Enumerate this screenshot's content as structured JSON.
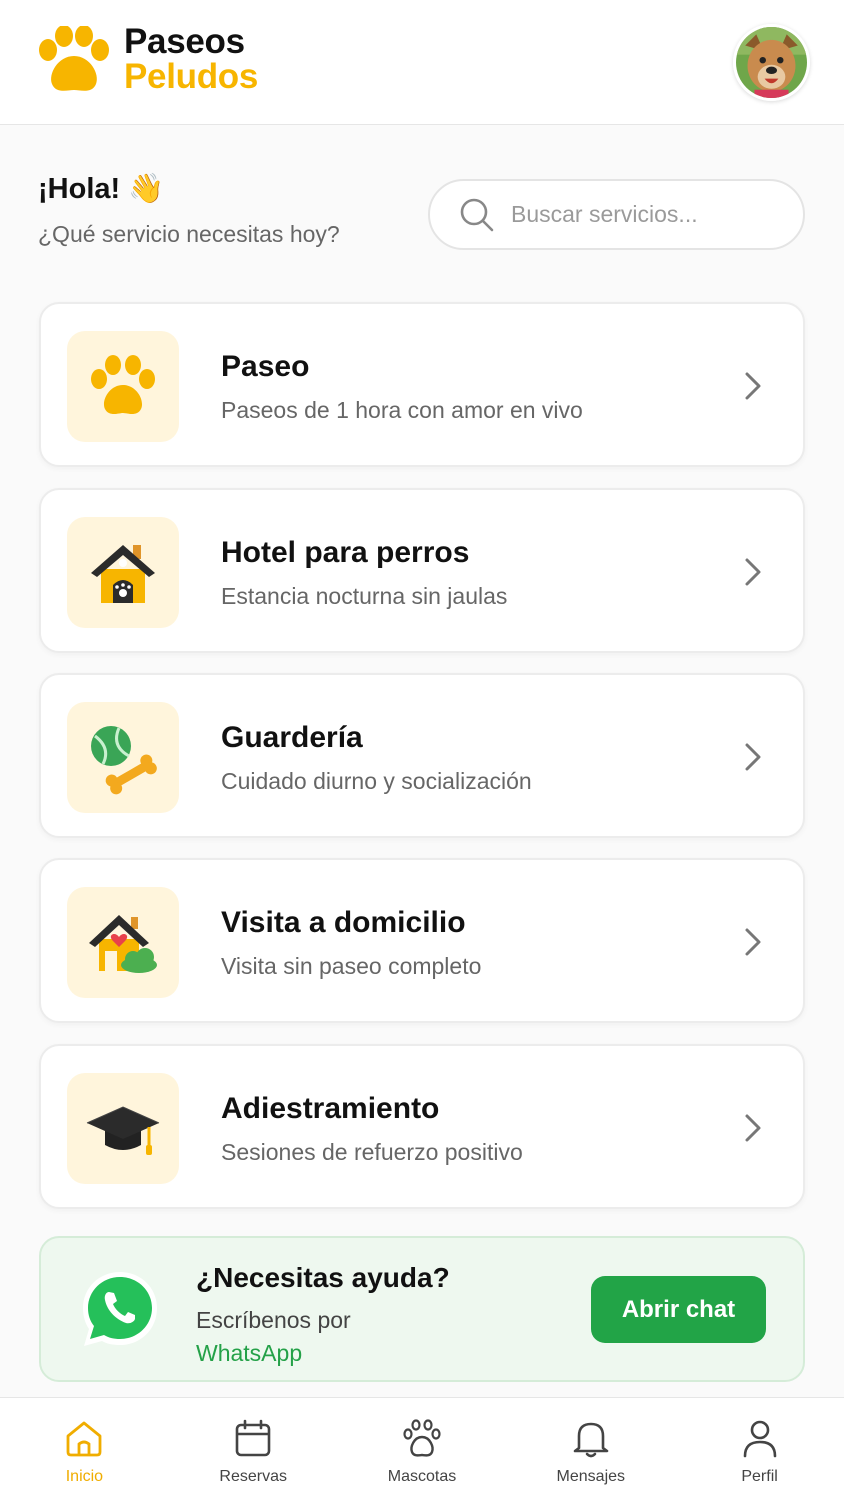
{
  "header": {
    "brand_line1": "Paseos",
    "brand_line2": "Peludos",
    "logo_icon": "paw-icon",
    "avatar_icon": "dog-avatar"
  },
  "greeting": {
    "title": "¡Hola!",
    "emoji": "👋",
    "subtitle": "¿Qué servicio necesitas hoy?"
  },
  "search": {
    "placeholder": "Buscar servicios..."
  },
  "services": [
    {
      "title": "Paseo",
      "subtitle": "Paseos de 1 hora con amor en vivo",
      "icon": "paw-icon"
    },
    {
      "title": "Hotel para perros",
      "subtitle": "Estancia nocturna sin jaulas",
      "icon": "dog-house-icon"
    },
    {
      "title": "Guardería",
      "subtitle": "Cuidado diurno y socialización",
      "icon": "ball-bone-icon"
    },
    {
      "title": "Visita a domicilio",
      "subtitle": "Visita sin paseo completo",
      "icon": "home-heart-icon"
    },
    {
      "title": "Adiestramiento",
      "subtitle": "Sesiones de refuerzo positivo",
      "icon": "graduation-cap-icon"
    }
  ],
  "help": {
    "title": "¿Necesitas ayuda?",
    "subtitle": "Escríbenos por",
    "link": "WhatsApp",
    "button": "Abrir chat"
  },
  "nav": {
    "items": [
      {
        "label": "Inicio",
        "icon": "home-icon",
        "active": true
      },
      {
        "label": "Reservas",
        "icon": "calendar-icon",
        "active": false
      },
      {
        "label": "Mascotas",
        "icon": "paw-icon",
        "active": false
      },
      {
        "label": "Mensajes",
        "icon": "bell-icon",
        "active": false
      },
      {
        "label": "Perfil",
        "icon": "user-icon",
        "active": false
      }
    ]
  },
  "colors": {
    "accent": "#f7b500",
    "whatsapp_green": "#22a447",
    "icon_bg": "#fff5dc",
    "help_bg": "#eef8ef"
  }
}
